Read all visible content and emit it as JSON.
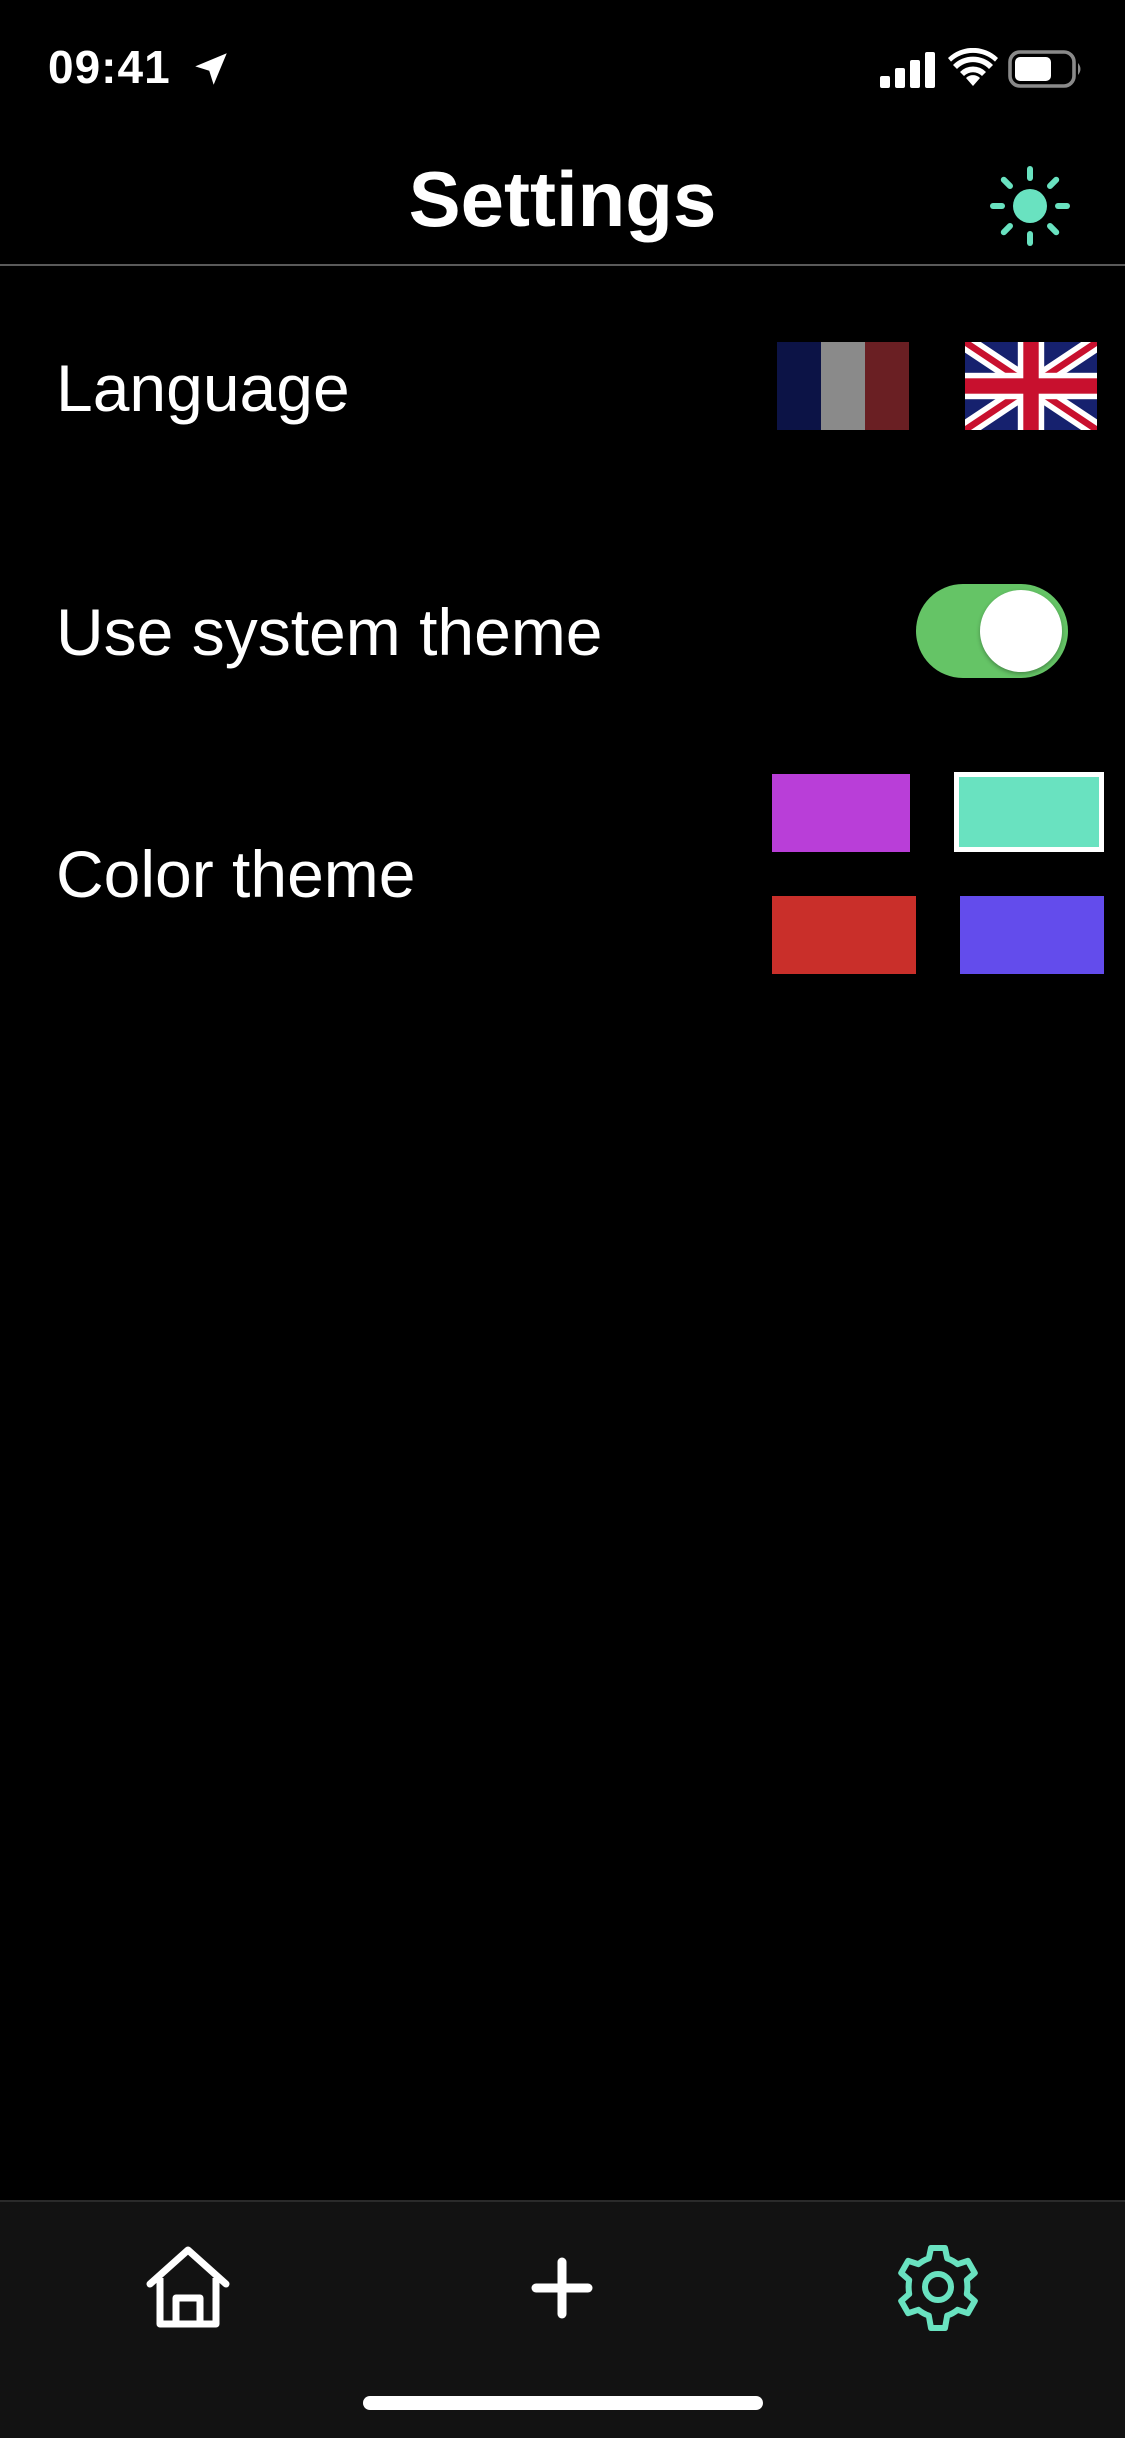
{
  "status_bar": {
    "time": "09:41",
    "icons": [
      "location-arrow-icon",
      "cellular-signal-icon",
      "wifi-icon",
      "battery-icon"
    ]
  },
  "header": {
    "title": "Settings",
    "theme_button_icon": "sun-icon"
  },
  "settings": {
    "language": {
      "label": "Language",
      "options": [
        {
          "name": "french-flag-icon"
        },
        {
          "name": "uk-flag-icon"
        }
      ]
    },
    "system_theme": {
      "label": "Use system theme",
      "enabled": true
    },
    "color_theme": {
      "label": "Color theme",
      "options": [
        {
          "color": "#b93ed8",
          "selected": false
        },
        {
          "color": "#69e2c0",
          "selected": true
        },
        {
          "color": "#c92f2a",
          "selected": false
        },
        {
          "color": "#634cec",
          "selected": false
        }
      ]
    }
  },
  "tab_bar": {
    "tabs": [
      {
        "icon": "home-icon",
        "active": false
      },
      {
        "icon": "plus-icon",
        "active": false
      },
      {
        "icon": "gear-icon",
        "active": true
      }
    ]
  },
  "colors": {
    "accent": "#69e2c0",
    "toggle_on": "#65c466",
    "background": "#000000",
    "tab_bar_background": "#121212"
  }
}
